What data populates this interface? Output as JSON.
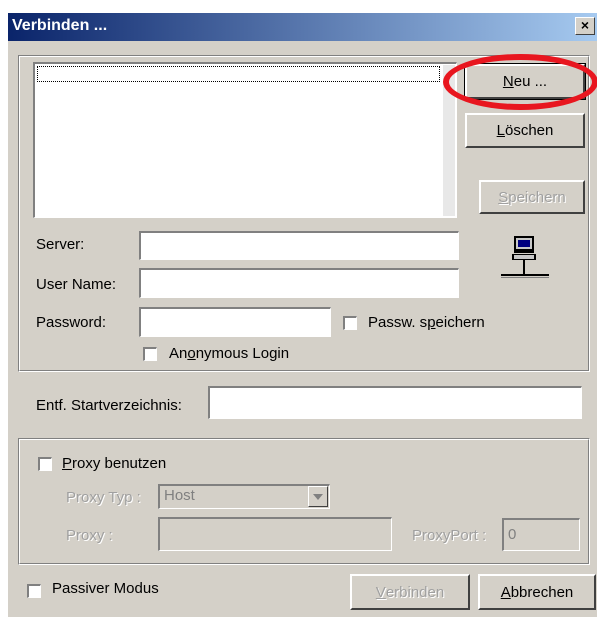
{
  "window": {
    "title": "Verbinden ...",
    "close_glyph": "×"
  },
  "buttons": {
    "new": {
      "pre": "",
      "key": "N",
      "post": "eu ..."
    },
    "delete": {
      "pre": "",
      "key": "L",
      "post": "öschen"
    },
    "save": {
      "pre": "",
      "key": "S",
      "post": "peichern"
    },
    "connect": {
      "pre": "",
      "key": "V",
      "post": "erbinden"
    },
    "cancel": {
      "pre": "",
      "key": "A",
      "post": "bbrechen"
    }
  },
  "labels": {
    "server": "Server:",
    "user_name": "User Name:",
    "password": "Password:",
    "remote_dir": "Entf. Startverzeichnis:",
    "proxy_type": "Proxy Typ :",
    "proxy": "Proxy :",
    "proxy_port": "ProxyPort :"
  },
  "checkboxes": {
    "save_password": {
      "pre": "Passw. s",
      "key": "p",
      "post": "eichern"
    },
    "anonymous": {
      "pre": "An",
      "key": "o",
      "post": "nymous Login"
    },
    "use_proxy": {
      "pre": "",
      "key": "P",
      "post": "roxy benutzen"
    },
    "passive": {
      "pre": "Passiver Modus",
      "key": "",
      "post": ""
    }
  },
  "fields": {
    "server": "",
    "user_name": "",
    "password": "",
    "remote_dir": "",
    "proxy_type": "Host",
    "proxy": "",
    "proxy_port": "0"
  },
  "icons": {
    "computer": "computer-icon",
    "combo": "dropdown-arrow-icon"
  },
  "colors": {
    "title_start": "#0a246a",
    "title_end": "#a6caf0",
    "face": "#d4d0c8",
    "highlight": "#e8161f"
  }
}
